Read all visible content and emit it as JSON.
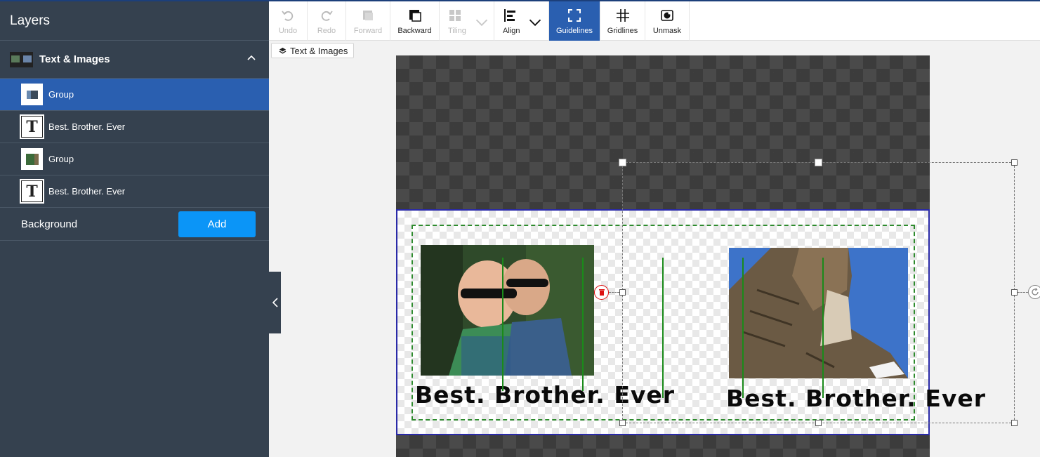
{
  "sidebar": {
    "title": "Layers",
    "section": {
      "label": "Text & Images"
    },
    "layers": [
      {
        "label": "Group",
        "kind": "image",
        "active": true
      },
      {
        "label": "Best. Brother. Ever",
        "kind": "text",
        "active": false
      },
      {
        "label": "Group",
        "kind": "image",
        "active": false
      },
      {
        "label": "Best. Brother. Ever",
        "kind": "text",
        "active": false
      }
    ],
    "background": {
      "label": "Background",
      "add_label": "Add"
    }
  },
  "toolbar": {
    "undo": "Undo",
    "redo": "Redo",
    "forward": "Forward",
    "backward": "Backward",
    "tiling": "Tiling",
    "align": "Align",
    "guidelines": "Guidelines",
    "gridlines": "Gridlines",
    "unmask": "Unmask"
  },
  "breadcrumb": {
    "label": "Text & Images"
  },
  "canvas": {
    "left_text": "Best. Brother. Ever",
    "right_text": "Best. Brother. Ever",
    "accent": "#2a5fb0",
    "guide_color": "#1a8a1a",
    "artboard_border": "#2a2aa8"
  }
}
